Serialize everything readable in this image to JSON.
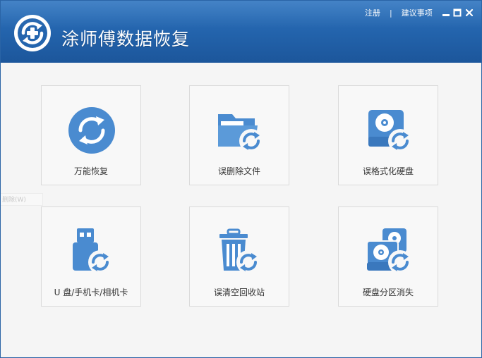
{
  "app": {
    "title": "涂师傅数据恢复",
    "accent_color": "#2465ae",
    "icon_color": "#4a8bd0"
  },
  "header": {
    "links": [
      "注册",
      "|",
      "建议事项"
    ],
    "window_controls": [
      "minimize-icon",
      "maximize-icon",
      "close-icon"
    ]
  },
  "ghost_text": "删除(W)",
  "tiles": [
    {
      "label": "万能恢复",
      "icon": "universal-recovery-icon"
    },
    {
      "label": "误删除文件",
      "icon": "deleted-folder-icon"
    },
    {
      "label": "误格式化硬盘",
      "icon": "formatted-disk-icon"
    },
    {
      "label": "U 盘/手机卡/相机卡",
      "icon": "usb-drive-icon"
    },
    {
      "label": "误清空回收站",
      "icon": "recycle-bin-icon"
    },
    {
      "label": "硬盘分区消失",
      "icon": "lost-partition-icon"
    }
  ]
}
